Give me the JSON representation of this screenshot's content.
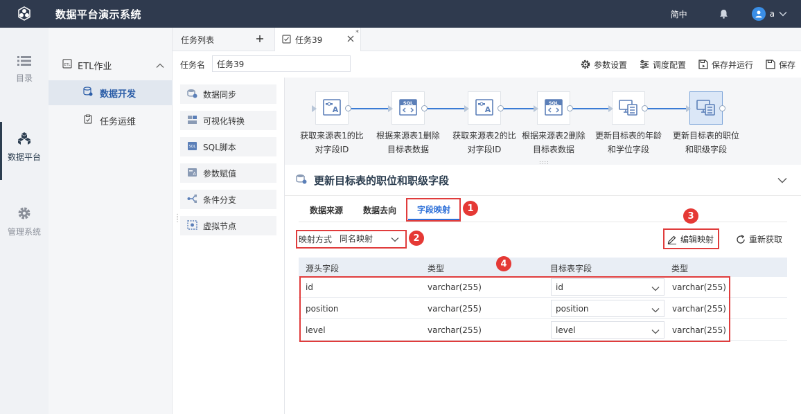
{
  "app": {
    "title": "数据平台演示系统",
    "lang": "简中",
    "user": "a"
  },
  "rail": [
    {
      "label": "目录",
      "icon": "list-icon"
    },
    {
      "label": "数据平台",
      "icon": "cube-cluster-icon",
      "active": true
    },
    {
      "label": "管理系统",
      "icon": "gear-icon"
    }
  ],
  "nav": {
    "group": "ETL作业",
    "items": [
      {
        "label": "数据开发",
        "active": true
      },
      {
        "label": "任务运维"
      }
    ]
  },
  "tabs": {
    "list_label": "任务列表",
    "task_label": "任务39",
    "modified_mark": "*"
  },
  "task": {
    "name_label": "任务名",
    "name_value": "任务39"
  },
  "toolbar": {
    "params": "参数设置",
    "schedule": "调度配置",
    "save_run": "保存并运行",
    "save": "保存"
  },
  "palette": [
    "数据同步",
    "可视化转换",
    "SQL脚本",
    "参数赋值",
    "条件分支",
    "虚拟节点"
  ],
  "nodes": [
    {
      "line1": "获取来源表1的比",
      "line2": "对字段ID",
      "type": "param"
    },
    {
      "line1": "根据来源表1删除",
      "line2": "目标表数据",
      "type": "sql"
    },
    {
      "line1": "获取来源表2的比",
      "line2": "对字段ID",
      "type": "param"
    },
    {
      "line1": "根据来源表2删除",
      "line2": "目标表数据",
      "type": "sql"
    },
    {
      "line1": "更新目标表的年龄",
      "line2": "和学位字段",
      "type": "sync"
    },
    {
      "line1": "更新目标表的职位",
      "line2": "和职级字段",
      "type": "sync",
      "selected": true
    }
  ],
  "details": {
    "title": "更新目标表的职位和职级字段",
    "tabs": [
      "数据来源",
      "数据去向",
      "字段映射"
    ],
    "active_tab": 2,
    "map_label": "映射方式",
    "map_value": "同名映射",
    "edit_map": "编辑映射",
    "refetch": "重新获取",
    "columns": [
      "源头字段",
      "类型",
      "目标表字段",
      "类型"
    ],
    "rows": [
      {
        "src": "id",
        "src_type": "varchar(255)",
        "target": "id",
        "target_type": "varchar(255)"
      },
      {
        "src": "position",
        "src_type": "varchar(255)",
        "target": "position",
        "target_type": "varchar(255)"
      },
      {
        "src": "level",
        "src_type": "varchar(255)",
        "target": "level",
        "target_type": "varchar(255)"
      }
    ]
  },
  "badges": [
    "1",
    "2",
    "3",
    "4"
  ],
  "colors": {
    "topbar": "#2f3a4e",
    "accent": "#2c6fd8",
    "annotation": "#e03c3c"
  }
}
